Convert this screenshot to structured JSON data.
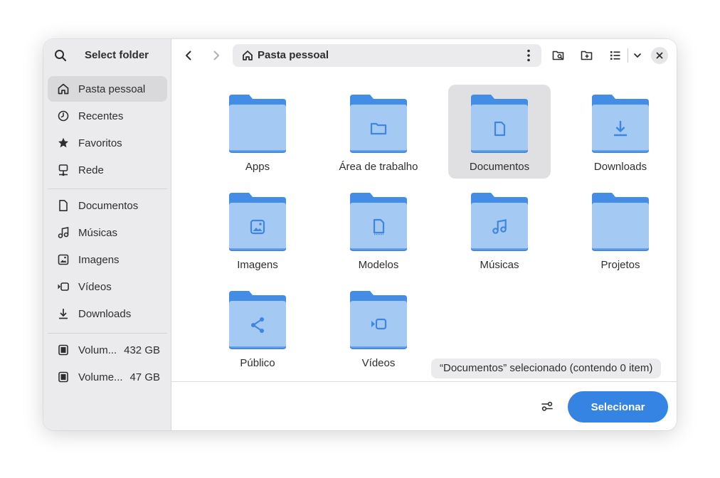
{
  "colors": {
    "accent": "#3584e4",
    "folder_back": "#438de6",
    "folder_front": "#a4c9f2",
    "folder_emblem": "#3f86e0",
    "icon": "#2e2e2e"
  },
  "sidebar": {
    "title": "Select folder",
    "search_icon": "search-icon",
    "places": [
      {
        "label": "Pasta pessoal",
        "icon": "home-icon",
        "active": true
      },
      {
        "label": "Recentes",
        "icon": "clock-icon",
        "active": false
      },
      {
        "label": "Favoritos",
        "icon": "star-icon",
        "active": false
      },
      {
        "label": "Rede",
        "icon": "network-icon",
        "active": false
      }
    ],
    "bookmarks": [
      {
        "label": "Documentos",
        "icon": "document-icon"
      },
      {
        "label": "Músicas",
        "icon": "music-icon"
      },
      {
        "label": "Imagens",
        "icon": "image-icon"
      },
      {
        "label": "Vídeos",
        "icon": "video-icon"
      },
      {
        "label": "Downloads",
        "icon": "download-icon"
      }
    ],
    "volumes": [
      {
        "label": "Volum...",
        "size": "432 GB",
        "icon": "drive-icon"
      },
      {
        "label": "Volume...",
        "size": "47 GB",
        "icon": "drive-icon"
      }
    ]
  },
  "toolbar": {
    "path_label": "Pasta pessoal",
    "back_icon": "back-arrow-icon",
    "forward_icon": "forward-arrow-icon",
    "search_folder_icon": "folder-search-icon",
    "new_folder_icon": "new-folder-icon",
    "view_icon": "list-view-icon",
    "view_menu_icon": "chevron-down-icon",
    "close_icon": "close-icon"
  },
  "folders": [
    {
      "name": "Apps",
      "emblem": "none",
      "selected": false
    },
    {
      "name": "Área de trabalho",
      "emblem": "folder",
      "selected": false
    },
    {
      "name": "Documentos",
      "emblem": "document",
      "selected": true
    },
    {
      "name": "Downloads",
      "emblem": "download",
      "selected": false
    },
    {
      "name": "Imagens",
      "emblem": "image",
      "selected": false
    },
    {
      "name": "Modelos",
      "emblem": "template",
      "selected": false
    },
    {
      "name": "Músicas",
      "emblem": "music",
      "selected": false
    },
    {
      "name": "Projetos",
      "emblem": "none",
      "selected": false
    },
    {
      "name": "Público",
      "emblem": "share",
      "selected": false
    },
    {
      "name": "Vídeos",
      "emblem": "video",
      "selected": false
    }
  ],
  "status_text": "“Documentos” selecionado  (contendo 0 item)",
  "footer": {
    "filter_icon": "filter-options-icon",
    "select_label": "Selecionar"
  }
}
